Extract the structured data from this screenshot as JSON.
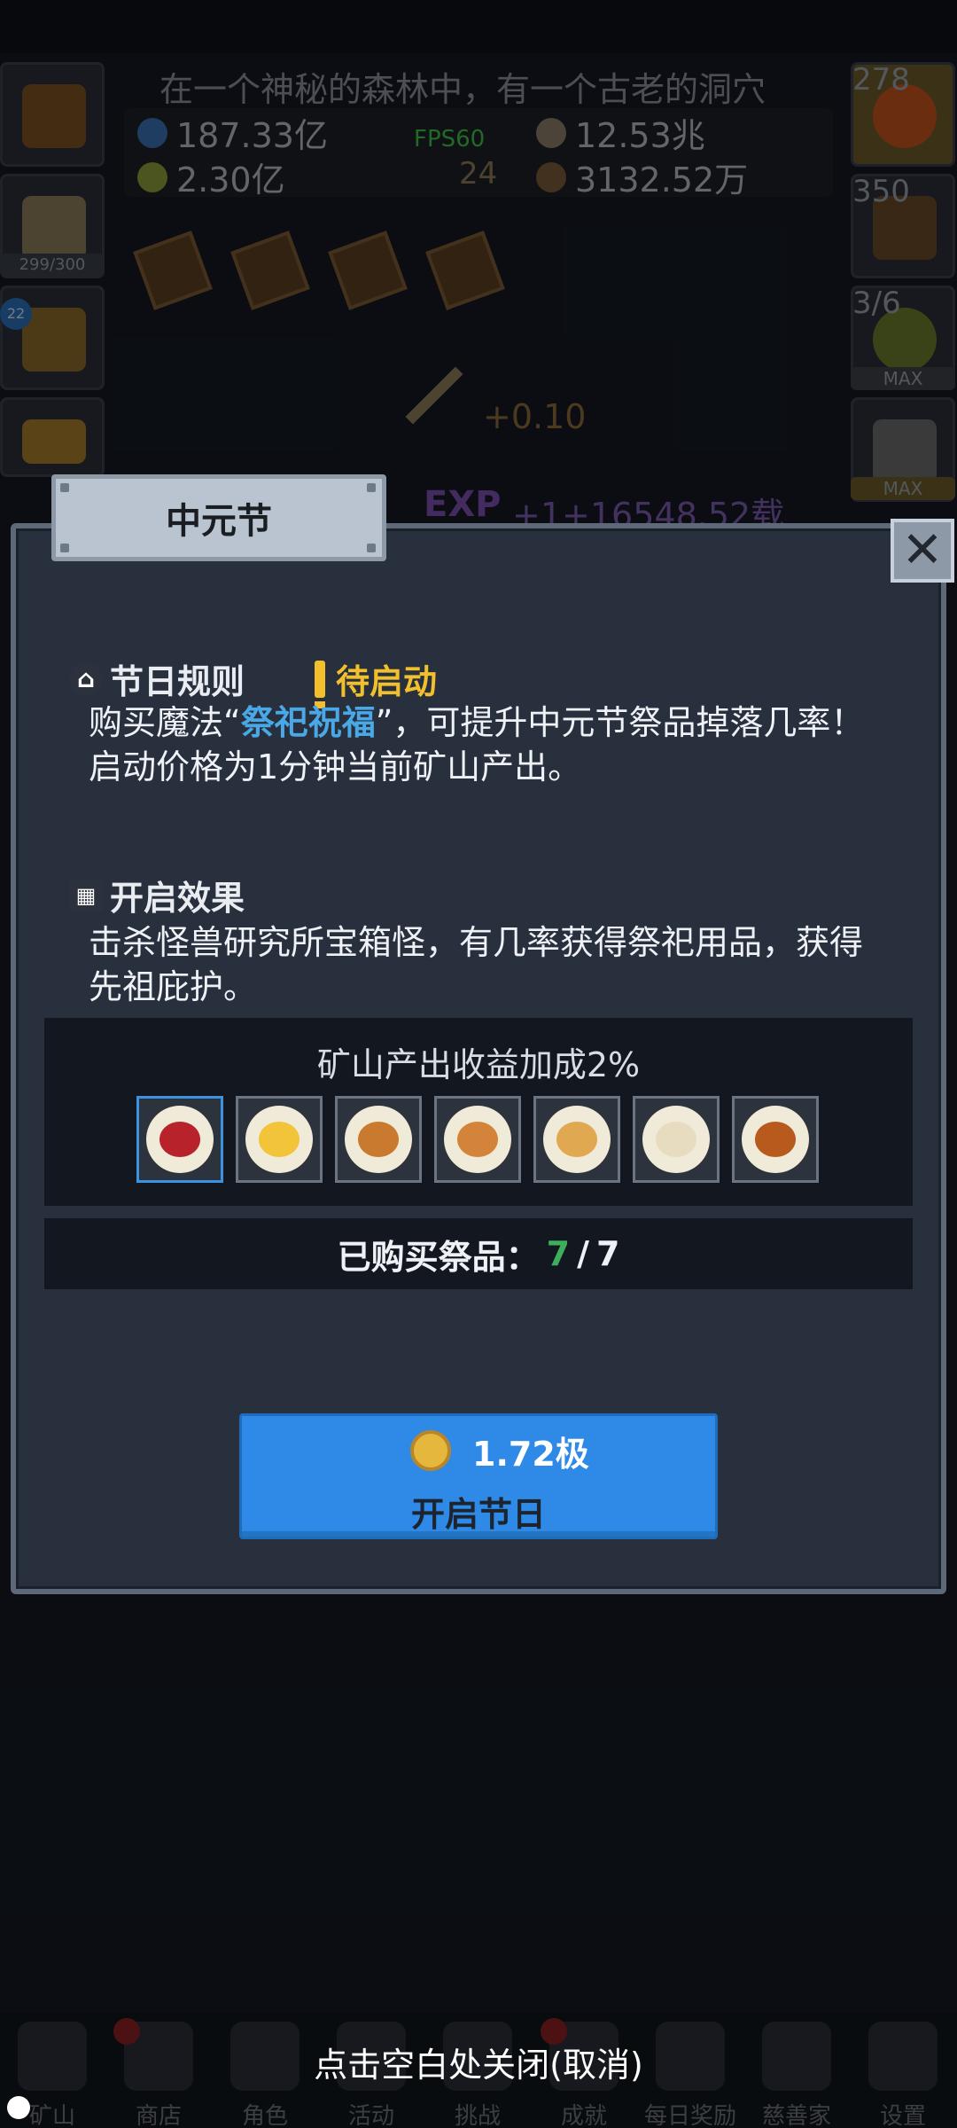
{
  "story": {
    "text": "在一个神秘的森林中，有一个古老的洞穴"
  },
  "resources": {
    "blue_potion": "187.33亿",
    "green_potion": "2.30亿",
    "ore": "12.53兆",
    "seed": "3132.52万",
    "fps": "FPS60",
    "level": "24"
  },
  "side_left": {
    "bag_count": "299/300",
    "badge": "22"
  },
  "side_right": {
    "potion_count": "278",
    "chest_count": "350",
    "slime_count": "3/6",
    "max_label": "MAX"
  },
  "floating": {
    "gain": "+0.10",
    "exp_label": "EXP",
    "exp_value": "+1+16548.52载"
  },
  "modal": {
    "title": "中元节",
    "close_label": "✕",
    "rules_heading": "节日规则",
    "status": "待启动",
    "rules_line1_pre": "购买魔法“",
    "rules_line1_highlight": "祭祀祝福",
    "rules_line1_post": "”，可提升中元节祭品掉落几率！",
    "rules_line2": "启动价格为1分钟当前矿山产出。",
    "effect_heading": "开启效果",
    "effect_line1": "击杀怪兽研究所宝箱怪，有几率获得祭祀用品，获得",
    "effect_line2": "先祖庇护。",
    "bonus_title": "矿山产出收益加成2%",
    "items": [
      "apple-plate",
      "banana-plate",
      "donut-plate",
      "bun-plate",
      "noodle-plate",
      "dumpling-plate",
      "roast-chicken-plate"
    ],
    "bought_label": "已购买祭品：",
    "bought_current": "7",
    "bought_sep": "/",
    "bought_total": "7",
    "price": "1.72极",
    "start_label": "开启节日"
  },
  "hint": "点击空白处关闭(取消)",
  "nav": [
    "矿山",
    "商店",
    "角色",
    "活动",
    "挑战",
    "成就",
    "每日奖励",
    "慈善家",
    "设置"
  ],
  "colors": {
    "accent": "#2e8ae6",
    "warn": "#f2c02d",
    "highlight": "#4aa8e6",
    "bought": "#3fae5c"
  }
}
